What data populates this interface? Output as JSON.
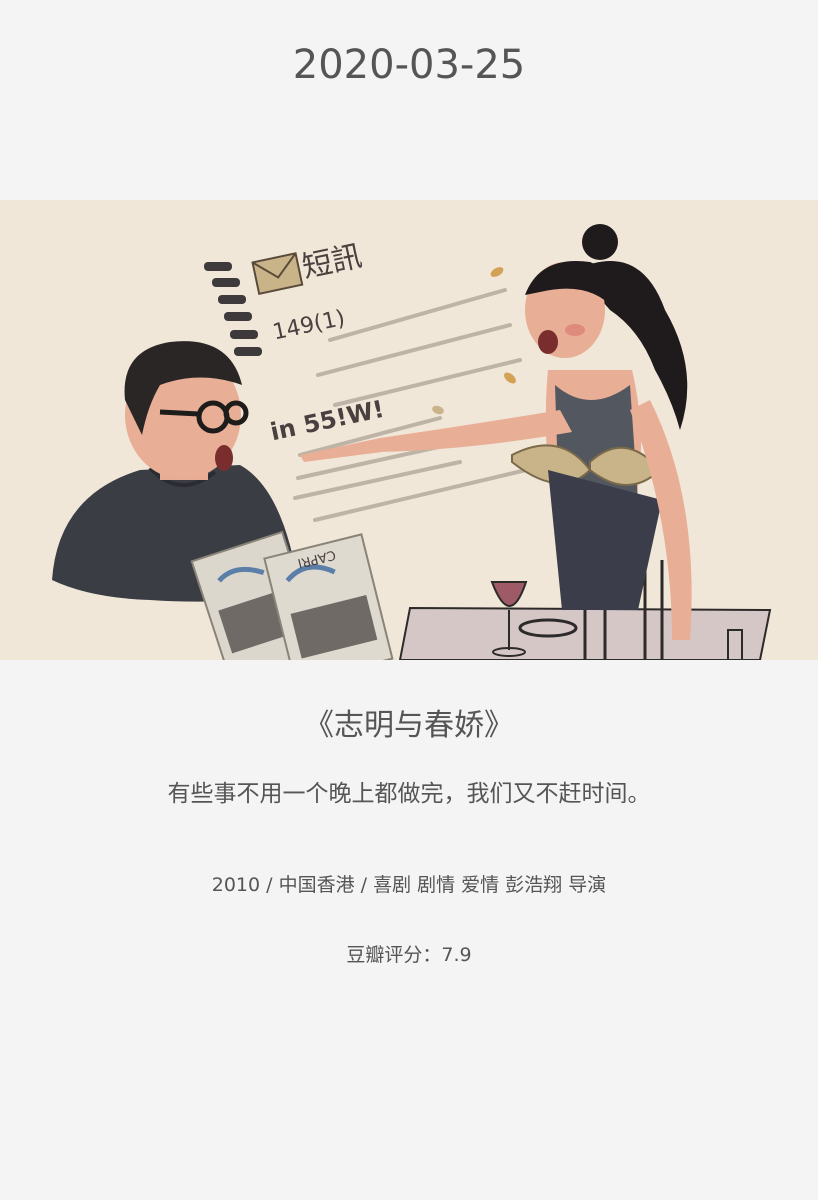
{
  "date": "2020-03-25",
  "illustration": {
    "subject": "movie-illustration",
    "sms_header": "短訊",
    "sms_number": "149(1)",
    "sms_text": "in 55!W!",
    "magazine_text": "CAPRI"
  },
  "movie": {
    "title": "《志明与春娇》",
    "quote": "有些事不用一个晚上都做完，我们又不赶时间。",
    "meta": "2010 / 中国香港 / 喜剧 剧情 爱情 彭浩翔 导演",
    "rating": "豆瓣评分：7.9"
  }
}
